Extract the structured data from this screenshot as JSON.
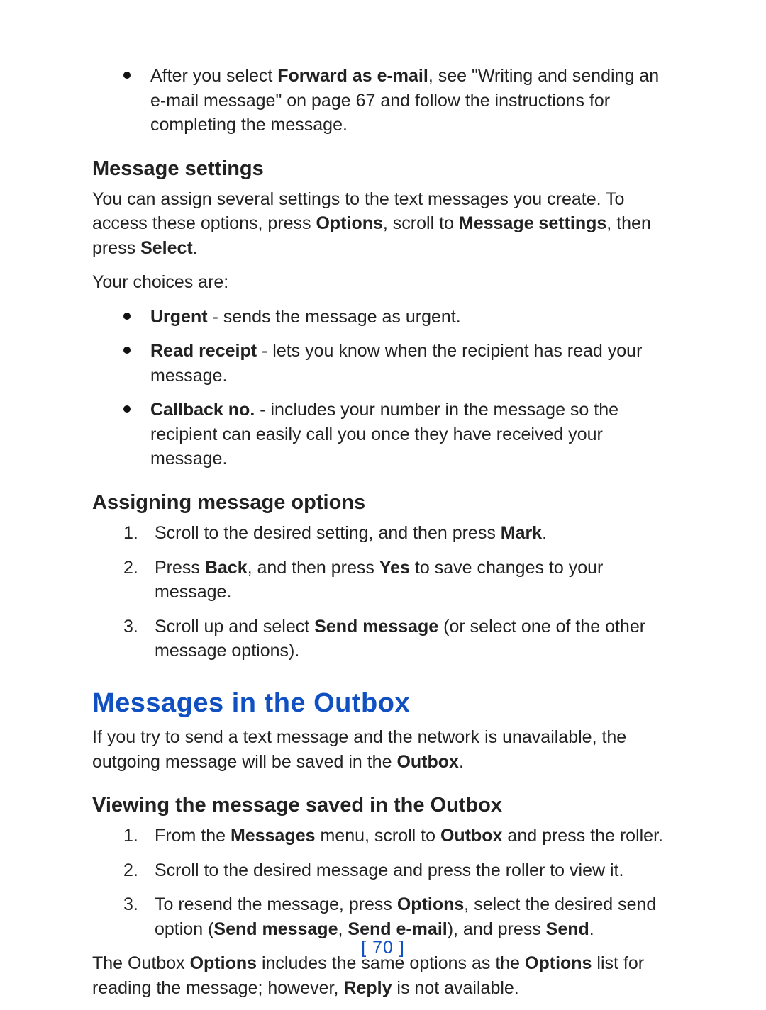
{
  "colors": {
    "accent": "#1050c0"
  },
  "intro_bullet": {
    "pre": "After you select ",
    "b1": "Forward as e-mail",
    "post": ", see \"Writing and sending an e-mail message\" on page 67 and follow the instructions for completing the message."
  },
  "msg_settings": {
    "heading": "Message settings",
    "intro_pre": "You can assign several settings to the text messages you create. To access these options, press ",
    "intro_b1": "Options",
    "intro_mid1": ", scroll to ",
    "intro_b2": "Message settings",
    "intro_mid2": ", then press ",
    "intro_b3": "Select",
    "intro_post": ".",
    "choices_label": "Your choices are:",
    "items": [
      {
        "b": "Urgent",
        "rest": " - sends the message as urgent."
      },
      {
        "b": "Read receipt",
        "rest": " - lets you know when the recipient has read your message."
      },
      {
        "b": "Callback no.",
        "rest": " - includes your number in the message so the recipient can easily call you once they have received your message."
      }
    ]
  },
  "assigning": {
    "heading": "Assigning message options",
    "step1_pre": "Scroll to the desired setting, and then press ",
    "step1_b": "Mark",
    "step1_post": ".",
    "step2_pre": "Press ",
    "step2_b1": "Back",
    "step2_mid": ", and then press ",
    "step2_b2": "Yes",
    "step2_post": " to save changes to your message.",
    "step3_pre": "Scroll up and select ",
    "step3_b": "Send message",
    "step3_post": " (or select one of the other message options).",
    "nums": [
      "1.",
      "2.",
      "3."
    ]
  },
  "outbox": {
    "heading": "Messages in the Outbox",
    "intro_pre": "If you try to send a text message and the network is unavailable, the outgoing message will be saved in the ",
    "intro_b": "Outbox",
    "intro_post": ".",
    "view_heading": "Viewing the message saved in the Outbox",
    "step1_pre": "From the ",
    "step1_b1": "Messages",
    "step1_mid": " menu, scroll to ",
    "step1_b2": "Outbox",
    "step1_post": " and press the roller.",
    "step2": "Scroll to the desired message and press the roller to view it.",
    "step3_pre": "To resend the message, press ",
    "step3_b1": "Options",
    "step3_mid1": ", select the desired send option (",
    "step3_b2": "Send message",
    "step3_mid2": ", ",
    "step3_b3": "Send e-mail",
    "step3_mid3": "), and press ",
    "step3_b4": "Send",
    "step3_post": ".",
    "nums": [
      "1.",
      "2.",
      "3."
    ],
    "outro_pre": "The Outbox ",
    "outro_b1": "Options",
    "outro_mid1": " includes the same options as the ",
    "outro_b2": "Options",
    "outro_mid2": " list for reading the message; however, ",
    "outro_b3": "Reply",
    "outro_post": " is not available."
  },
  "page_number": "[ 70 ]"
}
